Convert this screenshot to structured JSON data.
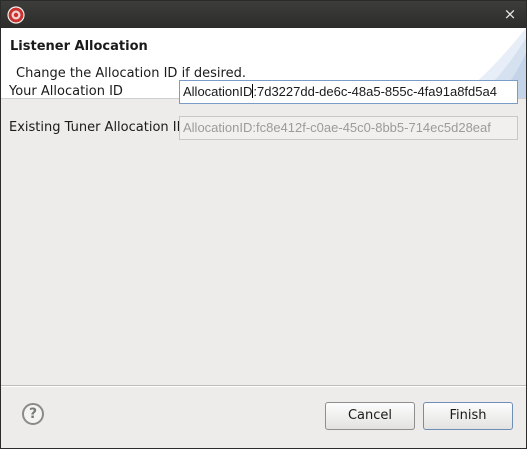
{
  "titlebar": {
    "close_glyph": "×"
  },
  "banner": {
    "title": "Listener Allocation",
    "message": "Change the Allocation ID if desired."
  },
  "form": {
    "your_allocation": {
      "label": "Your Allocation ID",
      "value_prefix": "AllocationID",
      "value_rest": ":7d3227dd-de6c-48a5-855c-4fa91a8fd5a4"
    },
    "existing_tuner": {
      "label": "Existing Tuner Allocation ID",
      "value": "AllocationID:fc8e412f-c0ae-45c0-8bb5-714ec5d28eaf"
    }
  },
  "footer": {
    "help_glyph": "?",
    "cancel_label": "Cancel",
    "finish_label": "Finish"
  },
  "colors": {
    "titlebar": "#2c2c2a",
    "accent_border": "#7a9cc6",
    "app_icon": "#c8322f"
  },
  "icons": {
    "app": "app-icon",
    "close": "close-icon",
    "help": "help-icon"
  }
}
